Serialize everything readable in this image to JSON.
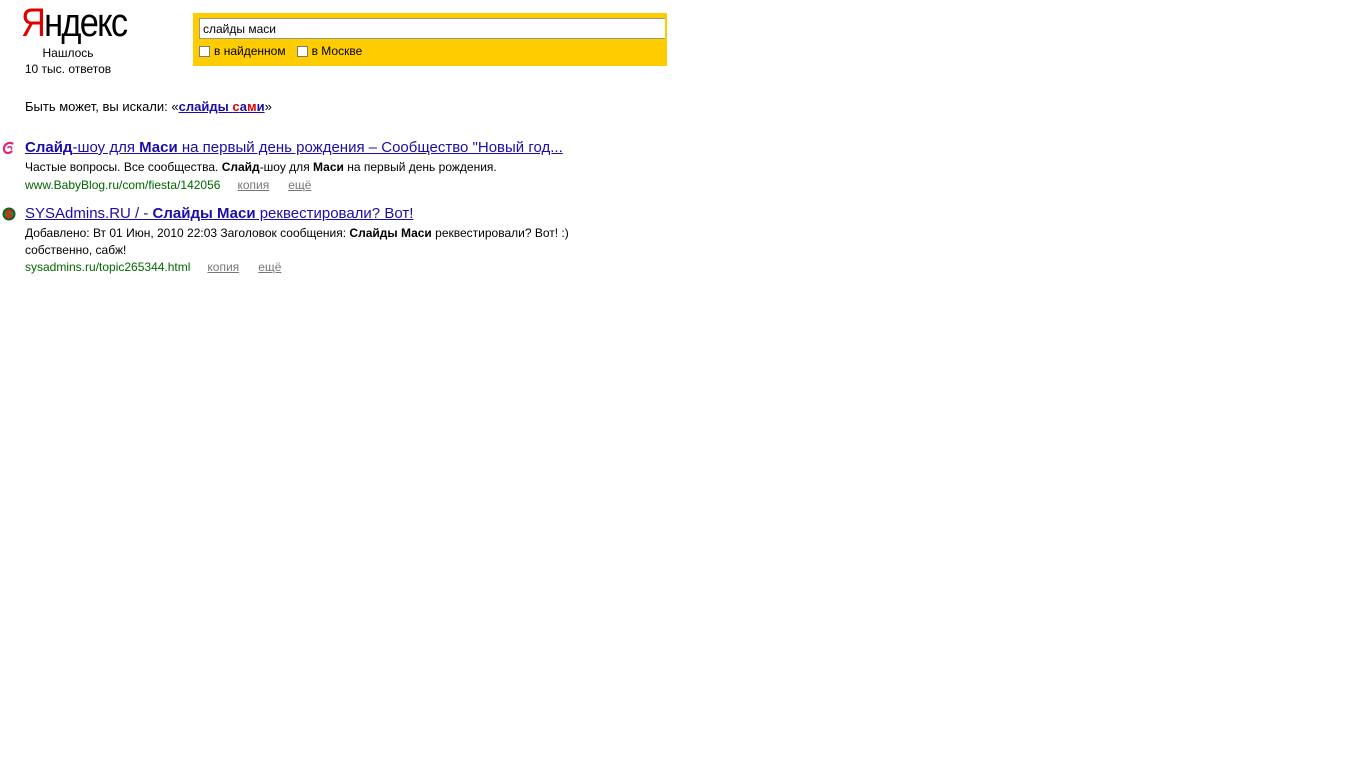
{
  "logo": {
    "first": "Я",
    "rest": "ндекс"
  },
  "found": {
    "line1": "Нашлось",
    "line2": "10 тыс. ответов"
  },
  "search": {
    "query": "слайды маси",
    "option_found": "в найденном",
    "option_region": "в Москве"
  },
  "suggestion": {
    "prefix": "Быть может, вы искали: «",
    "word1": "слайды",
    "word2_a": "с",
    "word2_b": "а",
    "word2_c": "м",
    "word2_d": "и",
    "suffix": "»"
  },
  "results": [
    {
      "title_b1": "Слайд",
      "title_t1": "-шоу для ",
      "title_b2": "Маси",
      "title_t2": " на первый день рождения – Сообщество \"Новый год...",
      "snippet_t1": "Частые вопросы. Все сообщества. ",
      "snippet_b1": "Слайд",
      "snippet_t2": "-шоу для ",
      "snippet_b2": "Маси",
      "snippet_t3": " на первый день рождения.",
      "url": "www.BabyBlog.ru/com/fiesta/142056",
      "copy": "копия",
      "more": "ещё"
    },
    {
      "title_t1": "SYSAdmins.RU / - ",
      "title_b1": "Слайды Маси",
      "title_t2": " реквестировали? Вот!",
      "snippet_t1": "Добавлено: Вт 01 Июн, 2010 22:03 Заголовок сообщения: ",
      "snippet_b1": "Слайды Маси",
      "snippet_t2": " реквестировали? Вот! :)",
      "snippet_line2": "собственно, сабж!",
      "url": "sysadmins.ru/topic265344.html",
      "copy": "копия",
      "more": "ещё"
    }
  ],
  "colors": {
    "search_bg": "#ffcc00",
    "link": "#1a0dab",
    "url": "#006600",
    "logo_red": "#e00000"
  }
}
